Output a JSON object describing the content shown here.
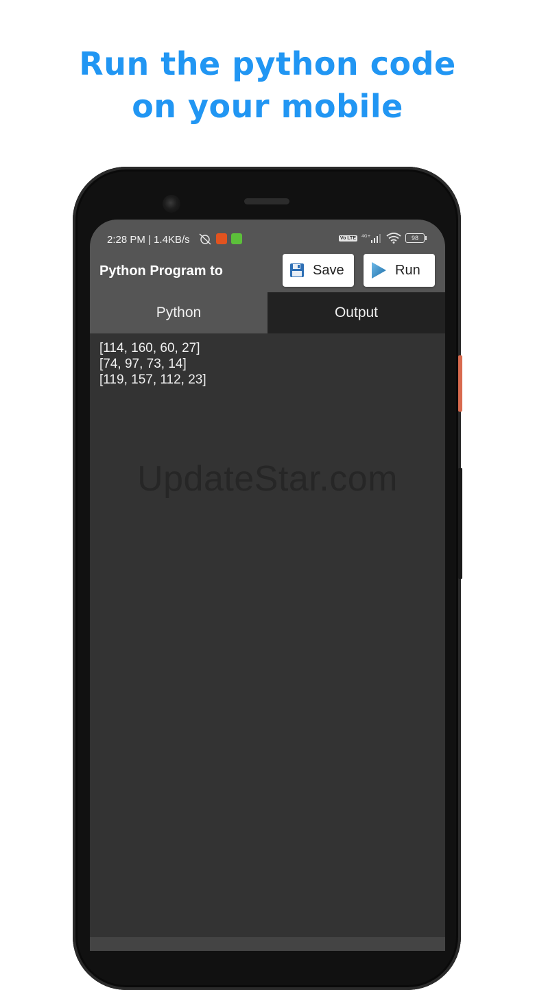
{
  "headline": {
    "line1": "Run the python code",
    "line2": "on your mobile"
  },
  "status_bar": {
    "time_speed": "2:28 PM | 1.4KB/s",
    "network_volte": "Vo LTE",
    "network_type": "4G+",
    "battery": "98"
  },
  "app_bar": {
    "title": "Python Program to",
    "save_label": "Save",
    "run_label": "Run"
  },
  "tabs": [
    {
      "label": "Python",
      "active": false
    },
    {
      "label": "Output",
      "active": true
    }
  ],
  "output_lines": [
    "[114, 160, 60, 27]",
    "[74, 97, 73, 14]",
    "[119, 157, 112, 23]"
  ],
  "watermark": "UpdateStar.com",
  "colors": {
    "headline": "#2196f3",
    "appbar": "#555555",
    "editor_bg": "#333333",
    "active_tab": "#222222"
  },
  "icons": {
    "save": "floppy-disk-icon",
    "run": "play-icon"
  }
}
